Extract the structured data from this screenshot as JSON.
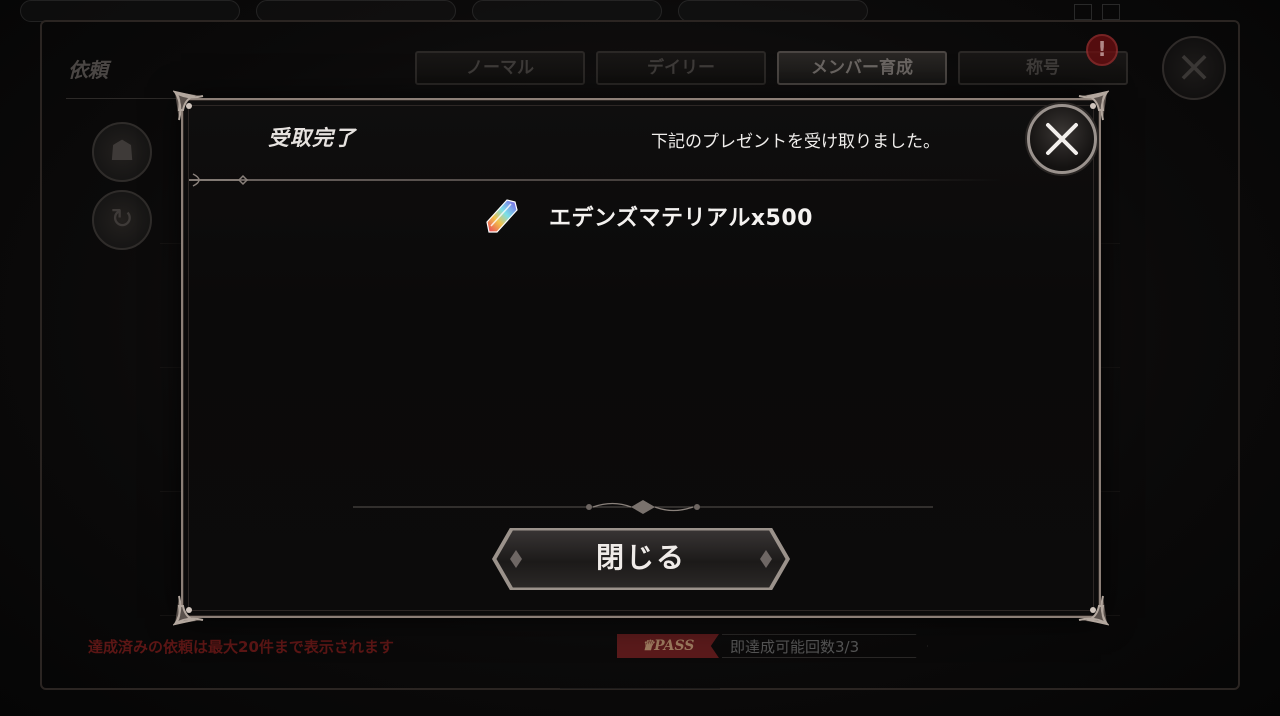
{
  "background": {
    "screen_title": "依頼",
    "tabs": [
      {
        "label": "ノーマル",
        "active": false
      },
      {
        "label": "デイリー",
        "active": false
      },
      {
        "label": "メンバー育成",
        "active": true
      },
      {
        "label": "称号",
        "active": false
      }
    ],
    "alert_icon": "!",
    "close_icon": "close-icon",
    "footer_note": "達成済みの依頼は最大20件まで表示されます",
    "pass_label": "PASS",
    "pass_count": "即達成可能回数3/3",
    "colors": {
      "footer_note": "#5c1615",
      "pass_badge": "#5a1a1b"
    }
  },
  "modal": {
    "title": "受取完了",
    "message": "下記のプレゼントを受け取りました。",
    "reward": {
      "icon": "crystal-icon",
      "label": "エデンズマテリアルx500"
    },
    "close_button_label": "閉じる",
    "close_icon": "close-icon"
  }
}
